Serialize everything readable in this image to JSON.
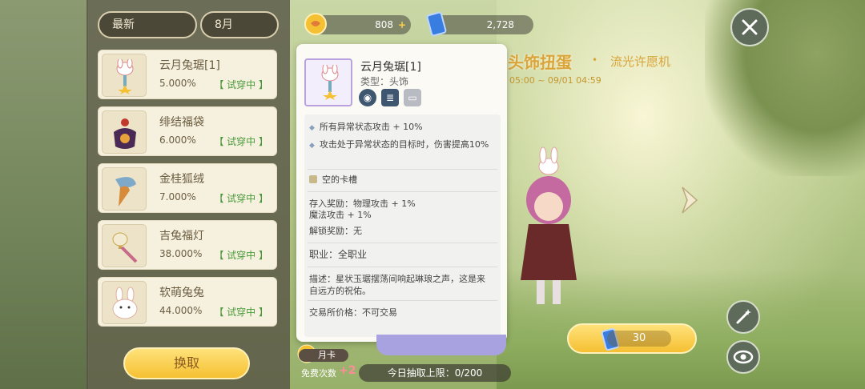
{
  "filters": {
    "sort": "最新",
    "month": "8月"
  },
  "items": [
    {
      "name": "云月兔琚[1]",
      "rate": "5.000%",
      "status": "【 试穿中 】",
      "icon": "rabbit-pendant-icon"
    },
    {
      "name": "绯结福袋",
      "rate": "6.000%",
      "status": "【 试穿中 】",
      "icon": "lucky-bag-icon"
    },
    {
      "name": "金桂狐绒",
      "rate": "7.000%",
      "status": "【 试穿中 】",
      "icon": "fox-tail-icon"
    },
    {
      "name": "吉兔福灯",
      "rate": "38.000%",
      "status": "【 试穿中 】",
      "icon": "lantern-icon"
    },
    {
      "name": "软萌兔兔",
      "rate": "44.000%",
      "status": "【 试穿中 】",
      "icon": "bunny-icon"
    }
  ],
  "exchange_label": "换取",
  "currency": {
    "coins": "808",
    "tickets": "2,728"
  },
  "banner": {
    "title": "头饰扭蛋",
    "sub": "流光许愿机",
    "time": "05:00 ~ 09/01 04:59"
  },
  "tooltip": {
    "name": "云月兔琚[1]",
    "type": "类型：头饰",
    "effect1": "所有异常状态攻击 + 10%",
    "effect2": "攻击处于异常状态的目标时，伤害提高10%",
    "slot": "空的卡槽",
    "deposit": "存入奖励：物理攻击 + 1%",
    "deposit2": "魔法攻击 + 1%",
    "unlock": "解锁奖励：无",
    "job": "职业：全职业",
    "desc": "描述：星状玉琚摆荡间响起琳琅之声，这是来自远方的祝佑。",
    "trade": "交易所价格：不可交易"
  },
  "bottom": {
    "month_card": "月卡",
    "free_count": "免费次数",
    "free_plus": "+2",
    "daily_limit": "今日抽取上限：0/200"
  },
  "cost": "30",
  "colors": {
    "accent": "#f5c032",
    "trial": "#4a9a3a",
    "tooltip_border": "#b9a2de"
  }
}
